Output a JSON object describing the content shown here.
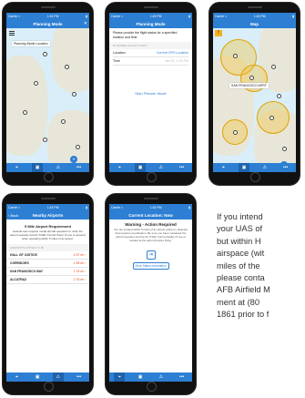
{
  "status": {
    "carrier": "Carrier ≈",
    "time": "1:43 PM",
    "battery": "▮"
  },
  "tabs": [
    "⌖",
    "▣",
    "⚠",
    "•••"
  ],
  "screen1": {
    "nav_title": "Planning Mode",
    "close": "✕",
    "location_label": "Planning Mode Location",
    "pin": "⌖"
  },
  "screen2": {
    "nav_title": "Planning Mode",
    "intro": "Please provide the flight status for a specified location and time.",
    "section": "PLANNED FLIGHT DATA",
    "rows": [
      {
        "label": "Location",
        "value": "Current GPS Location"
      },
      {
        "label": "Time",
        "value": "Jan 01, 1:43 PM"
      }
    ],
    "button": "Start Planner Mode"
  },
  "screen3": {
    "nav_title": "Map",
    "warn": "!",
    "label": "SAN FRANCISCO APRT",
    "locate": "◎"
  },
  "screen4": {
    "nav_left": "‹ Back",
    "nav_title": "Nearby Airports",
    "banner_title": "5 Mile Airport Requirement",
    "banner_text": "Federal Law requires model aircraft operators to notify the airport operator and Air Traffic Control Tower (if one is present) when operating within 5 miles of an airport.",
    "section": "AIRPORTS WITHIN 5 MI",
    "airports": [
      {
        "name": "HALL OF JUSTICE",
        "dist": "2.07 mi ›"
      },
      {
        "name": "CORRIDORS",
        "dist": "1.59 mi ›"
      },
      {
        "name": "SAN FRANCISCO BAY",
        "dist": "1.76 mi ›"
      },
      {
        "name": "ALCATRAZ",
        "dist": "2.76 mi ›"
      }
    ]
  },
  "screen5": {
    "nav_title": "Current Location: Now",
    "warn_title": "Warning - Action Required",
    "warn_text": "You are located within 5 miles of an airport and/or in airspace that requires coordination. Be sure you have contacted the airport operator and the Air Traffic Control facility (if one is located at the airport) before flying.",
    "icon": "⇥",
    "button": "More Status Information"
  },
  "caption": [
    "If you intend",
    "your UAS of",
    "but within H",
    "airspace (wit",
    "miles of the",
    "please conta",
    "AFB Airfield M",
    "ment at (80",
    "1861 prior to f"
  ]
}
